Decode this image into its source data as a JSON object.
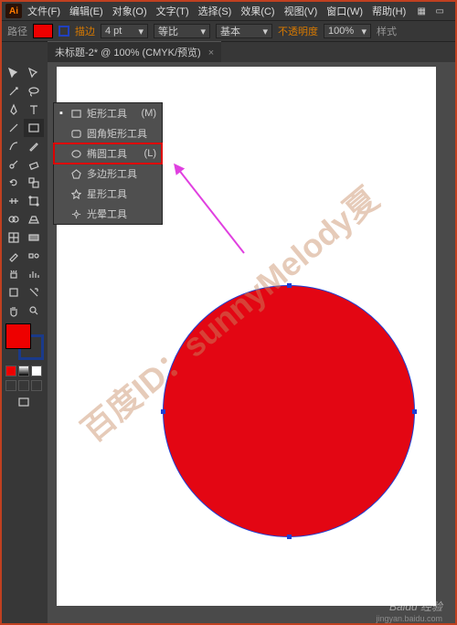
{
  "menu": {
    "items": [
      "文件(F)",
      "编辑(E)",
      "对象(O)",
      "文字(T)",
      "选择(S)",
      "效果(C)",
      "视图(V)",
      "窗口(W)",
      "帮助(H)"
    ]
  },
  "optbar": {
    "label": "路径",
    "stroke_lbl": "描边",
    "stroke_val": "4 pt",
    "uniform": "等比",
    "style": "基本",
    "opacity_lbl": "不透明度",
    "opacity_val": "100%",
    "style_lbl": "样式"
  },
  "tab": {
    "title": "未标题-2* @ 100% (CMYK/预览)"
  },
  "flyout": {
    "items": [
      {
        "label": "矩形工具",
        "key": "(M)"
      },
      {
        "label": "圆角矩形工具",
        "key": ""
      },
      {
        "label": "椭圆工具",
        "key": "(L)"
      },
      {
        "label": "多边形工具",
        "key": ""
      },
      {
        "label": "星形工具",
        "key": ""
      },
      {
        "label": "光晕工具",
        "key": ""
      }
    ]
  },
  "watermark": "百度ID：sunnyMelody夏",
  "baidu": {
    "brand": "Baidu 经验",
    "url": "jingyan.baidu.com"
  }
}
